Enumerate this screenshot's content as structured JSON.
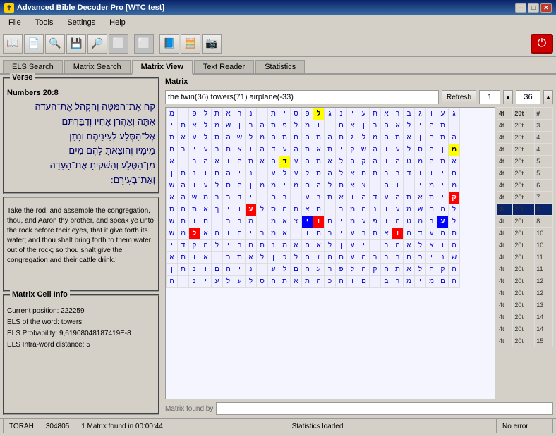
{
  "app": {
    "title": "Advanced Bible Decoder Pro [WTC test]",
    "icon": "✝"
  },
  "titlebar": {
    "minimize": "─",
    "maximize": "□",
    "close": "✕"
  },
  "menu": {
    "items": [
      "File",
      "Tools",
      "Settings",
      "Help"
    ]
  },
  "toolbar": {
    "buttons": [
      "📖",
      "📄",
      "🔍",
      "💾",
      "🔎",
      "⬜",
      "⬜",
      "📘",
      "🧮",
      "📷"
    ],
    "power_label": "⏻"
  },
  "tabs": [
    {
      "id": "els",
      "label": "ELS Search"
    },
    {
      "id": "matrix",
      "label": "Matrix Search"
    },
    {
      "id": "matrixview",
      "label": "Matrix View",
      "active": true
    },
    {
      "id": "textreader",
      "label": "Text Reader"
    },
    {
      "id": "statistics",
      "label": "Statistics"
    }
  ],
  "verse": {
    "panel_label": "Verse",
    "ref": "Numbers 20:8",
    "hebrew": "קַח אֶת־הַמַּטֶּה וְהַקְהֵל אֶת־הָעֵדָה\nאַתָּה וְאַהֲרֹן אָחִיו וְדִבַּרְתֶּם\nאֶל־הַסֶּלַע לְעֵינֵיהֶם וְנָתַן\nמֵימָיו וְהוֹצֵאתָ לָהֶם מַיִם\nמִן־הַסֶּלַע וְהִשְׁקִיתָ אֶת־הָעֵדָה\nוְאֶת־בְּעִירָם:",
    "english": "Take the rod, and assemble the congregation, thou, and Aaron thy brother, and speak ye unto the rock before their eyes, that it give forth its water; and thou shalt bring forth to them water out of the rock; so thou shalt give the congregation and their cattle drink.'"
  },
  "matrix": {
    "panel_label": "Matrix",
    "search_text": "the twin(36) towers(71) airplane(-33)",
    "refresh_label": "Refresh",
    "num_value": "1",
    "num_value2": "36",
    "found_label": "Matrix found by",
    "found_value": ""
  },
  "cell_info": {
    "panel_label": "Matrix Cell Info",
    "position_label": "Current position:",
    "position_value": "222259",
    "els_label": "ELS of the word:",
    "els_value": "towers",
    "prob_label": "ELS Probability:",
    "prob_value": "9,61908048187419E-8",
    "dist_label": "ELS Intra-word distance:",
    "dist_value": "5"
  },
  "matrix_grid": {
    "rows": [
      [
        "ג",
        "ע",
        "ו",
        "ג",
        "ב",
        "ר",
        "א",
        "ת",
        "ע",
        "י",
        "נ",
        "ג",
        "ל",
        "פ",
        "ס",
        "י",
        "ת",
        "י",
        "נ",
        "ר",
        "א",
        "ת",
        "ל",
        "פ",
        "ו",
        "מ"
      ],
      [
        "י",
        "ת",
        "ה",
        "י",
        "ל",
        "א",
        "ה",
        "ר",
        "ן",
        "א",
        "ח",
        "י",
        "ו",
        "מ",
        "ל",
        "פ",
        "ת",
        "ה",
        "ר",
        "ן",
        "ש",
        "מ",
        "ל",
        "א",
        "ת",
        "י"
      ],
      [
        "ה",
        "ת",
        "ח",
        "ן",
        "א",
        "ת",
        "ה",
        "מ",
        "ל",
        "ג",
        "ת",
        "ה",
        "ת",
        "ה",
        "ח",
        "ת",
        "ה",
        "מ",
        "ל",
        "ש",
        "ה",
        "ס",
        "ל",
        "ע",
        "א",
        "ת"
      ],
      [
        "מ",
        "ן",
        "ה",
        "ס",
        "ל",
        "ע",
        "ו",
        "ה",
        "ש",
        "ק",
        "י",
        "ת",
        "א",
        "ת",
        "ה",
        "ע",
        "ד",
        "ה",
        "ו",
        "א",
        "ת",
        "ב",
        "ע",
        "י",
        "ר",
        "ם"
      ],
      [
        "א",
        "ת",
        "ה",
        "מ",
        "ט",
        "ה",
        "ו",
        "ה",
        "ק",
        "ה",
        "ל",
        "א",
        "ת",
        "ה",
        "ע",
        "ד",
        "ה",
        "א",
        "ת",
        "ה",
        "ו",
        "א",
        "ה",
        "ר",
        "ן",
        "א"
      ],
      [
        "ח",
        "י",
        "ו",
        "ו",
        "ד",
        "ב",
        "ר",
        "ת",
        "ם",
        "א",
        "ל",
        "ה",
        "ס",
        "ל",
        "ע",
        "ל",
        "ע",
        "י",
        "נ",
        "י",
        "ה",
        "ם",
        "ו",
        "נ",
        "ת",
        "ן"
      ],
      [
        "מ",
        "י",
        "מ",
        "י",
        "ו",
        "ו",
        "ה",
        "ו",
        "צ",
        "א",
        "ת",
        "ל",
        "ה",
        "ם",
        "מ",
        "י",
        "מ",
        "מ",
        "ן",
        "ה",
        "ס",
        "ל",
        "ע",
        "ו",
        "ה",
        "ש"
      ],
      [
        "ק",
        "י",
        "ת",
        "א",
        "ת",
        "ה",
        "ע",
        "ד",
        "ה",
        "ו",
        "א",
        "ת",
        "ב",
        "ע",
        "י",
        "ר",
        "ם",
        "ו",
        "י",
        "ד",
        "ב",
        "ר",
        "מ",
        "ש",
        "ה",
        "א"
      ],
      [
        "ל",
        "ה",
        "ם",
        "ש",
        "מ",
        "ע",
        "ו",
        "נ",
        "ה",
        "מ",
        "ר",
        "י",
        "ם",
        "א",
        "ת",
        "ה",
        "ס",
        "ל",
        "ע",
        "ו",
        "י",
        "ך",
        "א",
        "ת",
        "ה",
        "ס"
      ],
      [
        "ל",
        "ע",
        "ב",
        "מ",
        "ט",
        "ה",
        "ו",
        "פ",
        "ע",
        "מ",
        "י",
        "ם",
        "ו",
        "י",
        "צ",
        "א",
        "מ",
        "י",
        "מ",
        "ר",
        "ב",
        "י",
        "ם",
        "ו",
        "ת",
        "ש"
      ],
      [
        "ת",
        "ה",
        "ע",
        "ד",
        "ה",
        "ו",
        "א",
        "ת",
        "ב",
        "ע",
        "י",
        "ר",
        "ם",
        "ו",
        "י",
        "א",
        "מ",
        "ר",
        "י",
        "ה",
        "ו",
        "ה",
        "א",
        "ל",
        "מ",
        "ש"
      ],
      [
        "ה",
        "ו",
        "א",
        "ל",
        "א",
        "ה",
        "ר",
        "ן",
        "י",
        "ע",
        "ן",
        "ל",
        "א",
        "ה",
        "א",
        "מ",
        "נ",
        "ת",
        "ם",
        "ב",
        "י",
        "ל",
        "ה",
        "ק",
        "ד",
        "י"
      ],
      [
        "ש",
        "נ",
        "י",
        "כ",
        "ם",
        "ב",
        "ר",
        "ב",
        "ה",
        "ע",
        "ם",
        "ה",
        "ז",
        "ה",
        "ל",
        "כ",
        "ן",
        "ל",
        "א",
        "ת",
        "ב",
        "י",
        "א",
        "ו",
        "ת",
        "א"
      ],
      [
        "ה",
        "ק",
        "ה",
        "ל",
        "א",
        "ת",
        "ה",
        "ק",
        "ה",
        "ל",
        "פ",
        "ר",
        "ע",
        "ה",
        "ם",
        "ל",
        "ע",
        "י",
        "נ",
        "י",
        "ה",
        "ם",
        "ו",
        "נ",
        "ת",
        "ן"
      ],
      [
        "ה",
        "ם",
        "מ",
        "י",
        "מ",
        "ר",
        "ב",
        "י",
        "ם",
        "ו",
        "ה",
        "כ",
        "ה",
        "ת",
        "א",
        "ת",
        "ה",
        "ס",
        "ל",
        "ע",
        "ל",
        "ע",
        "י",
        "נ",
        "י",
        "ה"
      ]
    ],
    "special_cells": {
      "yellow": [
        [
          0,
          12
        ],
        [
          3,
          0
        ],
        [
          4,
          15
        ]
      ],
      "blue": [
        [
          9,
          1
        ],
        [
          9,
          13
        ]
      ],
      "red": [
        [
          7,
          0
        ],
        [
          8,
          18
        ],
        [
          9,
          12
        ],
        [
          10,
          5
        ],
        [
          10,
          23
        ]
      ]
    },
    "highlighted_row": 7
  },
  "side_data": {
    "headers": [
      "4t",
      "20t",
      "#"
    ],
    "rows": [
      {
        "cols": [
          "4t",
          "20t",
          "3"
        ],
        "selected": false
      },
      {
        "cols": [
          "4t",
          "20t",
          "4"
        ],
        "selected": false
      },
      {
        "cols": [
          "4t",
          "20t",
          "4"
        ],
        "selected": false
      },
      {
        "cols": [
          "4t",
          "20t",
          "5"
        ],
        "selected": false
      },
      {
        "cols": [
          "4t",
          "20t",
          "5"
        ],
        "selected": false
      },
      {
        "cols": [
          "4t",
          "20t",
          "6"
        ],
        "selected": false
      },
      {
        "cols": [
          "4t",
          "20t",
          "7"
        ],
        "selected": false
      },
      {
        "cols": [
          "4t",
          "20t",
          "8"
        ],
        "selected": true
      },
      {
        "cols": [
          "4t",
          "20t",
          "8"
        ],
        "selected": false
      },
      {
        "cols": [
          "4t",
          "20t",
          "10"
        ],
        "selected": false
      },
      {
        "cols": [
          "4t",
          "20t",
          "10"
        ],
        "selected": false
      },
      {
        "cols": [
          "4t",
          "20t",
          "11"
        ],
        "selected": false
      },
      {
        "cols": [
          "4t",
          "20t",
          "11"
        ],
        "selected": false
      },
      {
        "cols": [
          "4t",
          "20t",
          "12"
        ],
        "selected": false
      },
      {
        "cols": [
          "4t",
          "20t",
          "12"
        ],
        "selected": false
      },
      {
        "cols": [
          "4t",
          "20t",
          "13"
        ],
        "selected": false
      },
      {
        "cols": [
          "4t",
          "20t",
          "14"
        ],
        "selected": false
      },
      {
        "cols": [
          "4t",
          "20t",
          "14"
        ],
        "selected": false
      },
      {
        "cols": [
          "4t",
          "20t",
          "15"
        ],
        "selected": false
      }
    ]
  },
  "statusbar": {
    "torah": "TORAH",
    "count": "304805",
    "matrix_found": "1 Matrix found in 00:00:44",
    "stats": "Statistics loaded",
    "error": "No error"
  }
}
